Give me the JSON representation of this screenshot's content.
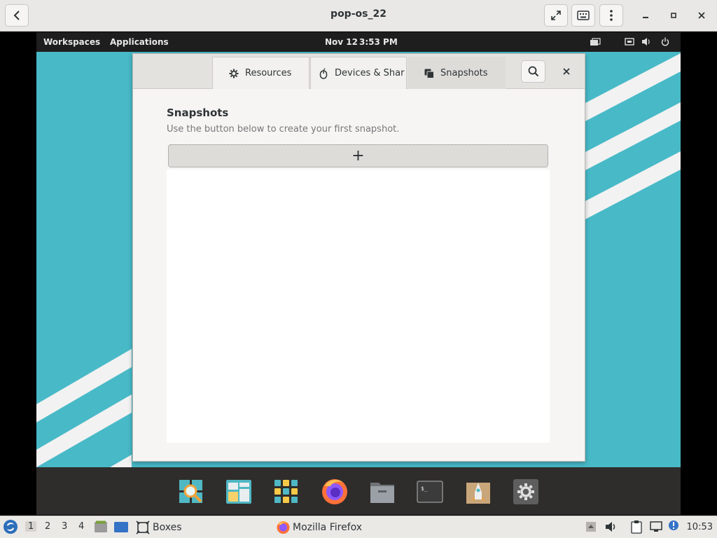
{
  "host_window": {
    "title": "pop-os_22",
    "back_icon": "back-arrow-icon",
    "fullscreen_icon": "fullscreen-icon",
    "keyboard_icon": "keyboard-icon",
    "menu_icon": "kebab-menu-icon"
  },
  "guest_topbar": {
    "workspaces": "Workspaces",
    "applications": "Applications",
    "date": "Nov 12",
    "time": "3:53 PM"
  },
  "dialog": {
    "tabs": [
      {
        "label": "Resources",
        "icon": "gear-icon"
      },
      {
        "label": "Devices & Shar",
        "icon": "mouse-icon"
      },
      {
        "label": "Snapshots",
        "icon": "snapshots-icon"
      }
    ],
    "active_tab": "Snapshots",
    "section_title": "Snapshots",
    "section_subtitle": "Use the button below to create your first snapshot.",
    "add_label": "+"
  },
  "dock": {
    "apps": [
      "search",
      "files-manager",
      "app-grid",
      "firefox",
      "files",
      "terminal",
      "launcher",
      "settings"
    ]
  },
  "host_panel": {
    "workspaces": [
      "1",
      "2",
      "3",
      "4"
    ],
    "active_workspace": "1",
    "task1": "Boxes",
    "task2": "Mozilla Firefox",
    "clock": "10:53"
  },
  "colors": {
    "teal": "#48b9c7",
    "dark_bar": "#1e1e1e",
    "dock_bg": "#2f2d2b"
  }
}
